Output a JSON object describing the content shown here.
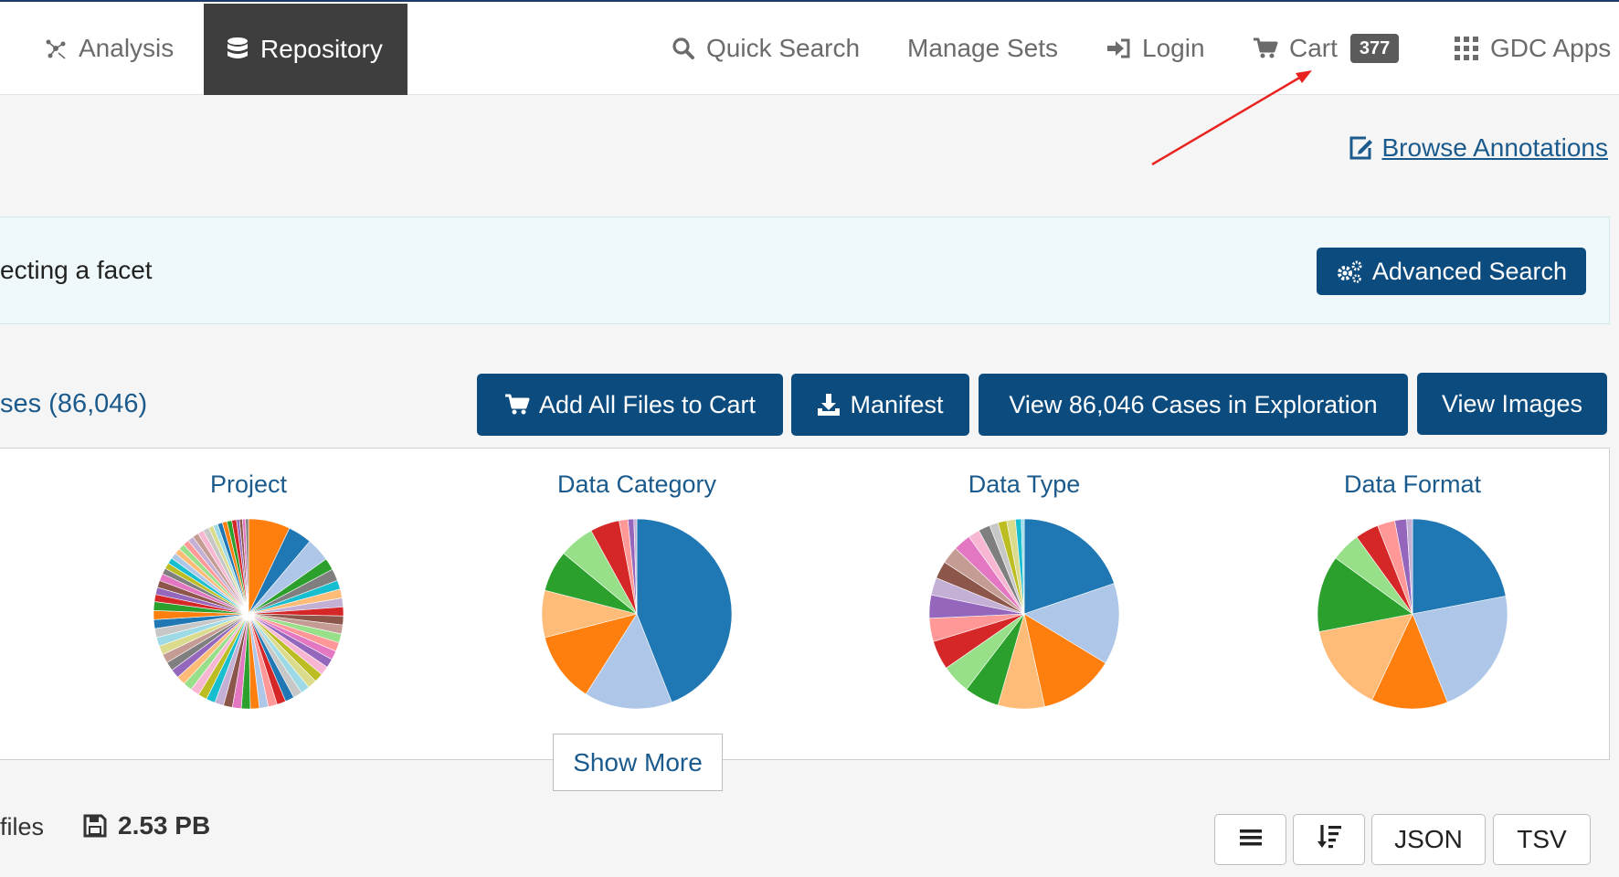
{
  "nav": {
    "analysis": "Analysis",
    "repository": "Repository",
    "quick_search": "Quick Search",
    "manage_sets": "Manage Sets",
    "login": "Login",
    "cart": "Cart",
    "cart_count": "377",
    "gdc_apps": "GDC Apps"
  },
  "links": {
    "browse_annotations": "Browse Annotations"
  },
  "banner": {
    "text": "ecting a facet",
    "advanced_search": "Advanced Search"
  },
  "actions": {
    "cases_count_text": "ses (86,046)",
    "add_all_files": "Add All Files to Cart",
    "manifest": "Manifest",
    "view_cases": "View 86,046 Cases in Exploration",
    "view_images": "View Images"
  },
  "charts": {
    "show_more": "Show More"
  },
  "chart_data": [
    {
      "type": "pie",
      "title": "Project",
      "values": [
        7,
        4,
        4,
        2,
        2,
        1.5,
        1.5,
        1.5,
        1.5,
        1.5,
        1.5,
        1.5,
        1.5,
        1.5,
        1.5,
        1.5,
        1.5,
        1.5,
        1.5,
        1.5,
        1.5,
        1.5,
        1.5,
        1.5,
        1.5,
        1.5,
        1.5,
        1.5,
        1.5,
        1.5,
        1.5,
        1.5,
        1.5,
        1.5,
        1.5,
        1.5,
        1.5,
        1.5,
        1.5,
        1.5,
        1.5,
        1.5,
        1.5,
        1.2,
        1.2,
        1.2,
        1.2,
        1,
        1,
        1,
        1,
        1,
        1,
        1,
        1,
        1,
        1,
        1,
        0.8,
        0.8,
        0.8,
        0.8,
        0.8,
        0.8,
        0.5,
        0.5,
        0.5,
        0.5
      ],
      "colors": [
        "#ff7f0e",
        "#1f77b4",
        "#aec7e8",
        "#2ca02c",
        "#7f7f7f",
        "#17becf",
        "#ffbb78",
        "#c5b0d5",
        "#d62728",
        "#8c564b",
        "#c49c94",
        "#98df8a",
        "#ff9896",
        "#e377c2",
        "#9467bd",
        "#f7b6d2",
        "#bcbd22",
        "#dbdb8d",
        "#9edae5",
        "#c7c7c7",
        "#1f77b4",
        "#d62728",
        "#ff9896",
        "#aec7e8",
        "#ff7f0e",
        "#2ca02c",
        "#e377c2",
        "#8c564b",
        "#c5b0d5",
        "#17becf",
        "#bcbd22",
        "#f7b6d2",
        "#98df8a",
        "#ffbb78",
        "#9467bd",
        "#7f7f7f",
        "#c49c94",
        "#dbdb8d",
        "#9edae5",
        "#c7c7c7",
        "#1f77b4",
        "#ff7f0e",
        "#2ca02c",
        "#d62728",
        "#9467bd",
        "#8c564b",
        "#e377c2",
        "#7f7f7f",
        "#bcbd22",
        "#17becf",
        "#aec7e8",
        "#ffbb78",
        "#98df8a",
        "#ff9896",
        "#c5b0d5",
        "#c49c94",
        "#f7b6d2",
        "#c7c7c7",
        "#dbdb8d",
        "#9edae5",
        "#1f77b4",
        "#ff7f0e",
        "#2ca02c",
        "#d62728",
        "#9467bd",
        "#8c564b",
        "#e377c2",
        "#7f7f7f"
      ]
    },
    {
      "type": "pie",
      "title": "Data Category",
      "values": [
        44,
        15,
        12,
        8,
        7,
        6,
        5,
        1.5,
        1,
        0.5
      ],
      "colors": [
        "#1f77b4",
        "#aec7e8",
        "#ff7f0e",
        "#ffbb78",
        "#2ca02c",
        "#98df8a",
        "#d62728",
        "#ff9896",
        "#9467bd",
        "#c5b0d5"
      ]
    },
    {
      "type": "pie",
      "title": "Data Type",
      "values": [
        20,
        14,
        13,
        8,
        6,
        5,
        5,
        4,
        4,
        3,
        3,
        3,
        3,
        2,
        2,
        1.5,
        1.5,
        1.5,
        1,
        0.5
      ],
      "colors": [
        "#1f77b4",
        "#aec7e8",
        "#ff7f0e",
        "#ffbb78",
        "#2ca02c",
        "#98df8a",
        "#d62728",
        "#ff9896",
        "#9467bd",
        "#c5b0d5",
        "#8c564b",
        "#c49c94",
        "#e377c2",
        "#f7b6d2",
        "#7f7f7f",
        "#c7c7c7",
        "#bcbd22",
        "#dbdb8d",
        "#17becf",
        "#9edae5"
      ]
    },
    {
      "type": "pie",
      "title": "Data Format",
      "values": [
        22,
        22,
        13,
        15,
        13,
        5,
        4,
        3,
        2,
        1
      ],
      "colors": [
        "#1f77b4",
        "#aec7e8",
        "#ff7f0e",
        "#ffbb78",
        "#2ca02c",
        "#98df8a",
        "#d62728",
        "#ff9896",
        "#9467bd",
        "#c5b0d5"
      ]
    }
  ],
  "summary": {
    "files_text": "files",
    "total_size": "2.53 PB"
  },
  "tools": {
    "json": "JSON",
    "tsv": "TSV"
  },
  "annotation": {
    "arrow_color": "#e8231f"
  }
}
